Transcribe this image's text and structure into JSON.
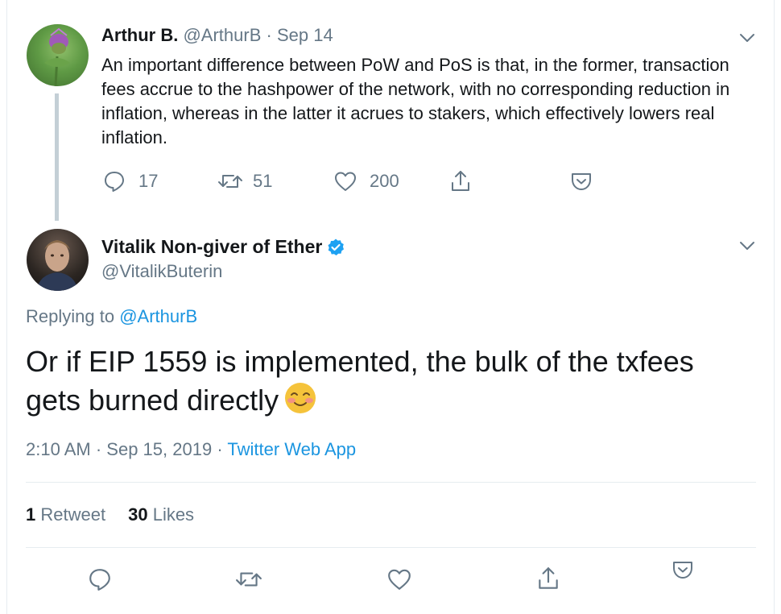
{
  "parent_tweet": {
    "display_name": "Arthur B.",
    "handle": "@ArthurB",
    "separator": "·",
    "date": "Sep 14",
    "text": "An important difference between PoW and PoS is that, in the former, transaction fees accrue to the hashpower of the network, with no corresponding reduction in inflation, whereas in the latter it acrues to stakers, which effectively lowers real inflation.",
    "reply_count": "17",
    "retweet_count": "51",
    "like_count": "200"
  },
  "main_tweet": {
    "display_name": "Vitalik Non-giver of Ether",
    "handle": "@VitalikButerin",
    "verified": true,
    "replying_prefix": "Replying to",
    "replying_handle": "@ArthurB",
    "text": "Or if EIP 1559 is implemented, the bulk of the txfees gets burned directly",
    "emoji": "smiling-face-with-blush",
    "time": "2:10 AM",
    "separator": "·",
    "date": "Sep 15, 2019",
    "source": "Twitter Web App",
    "retweet_count": "1",
    "retweet_label": "Retweet",
    "like_count": "30",
    "like_label": "Likes"
  },
  "colors": {
    "text": "#14171a",
    "muted": "#657786",
    "link": "#1b95e0",
    "divider": "#e6ecf0",
    "thread_line": "#c4cfd6",
    "verified": "#1da1f2"
  }
}
